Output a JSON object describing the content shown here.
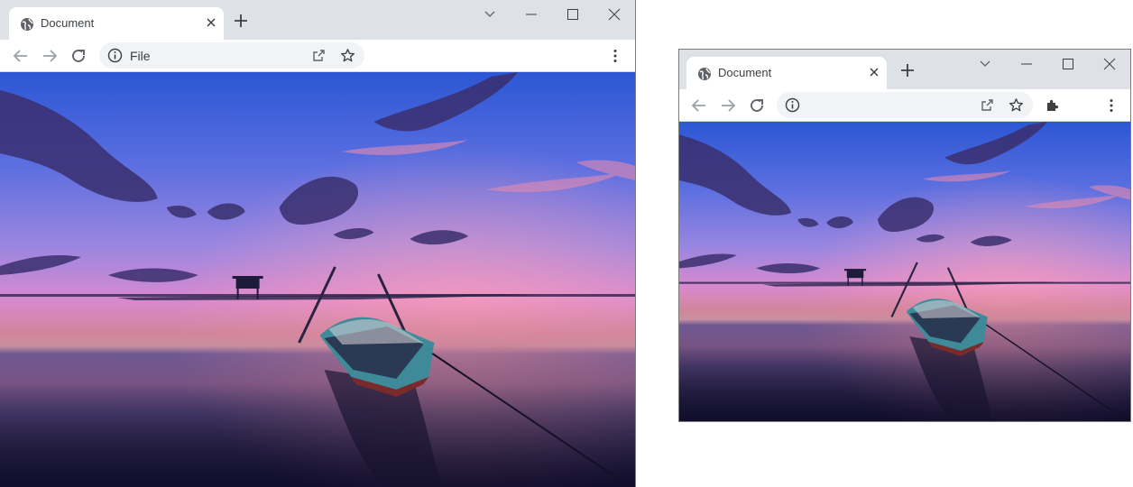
{
  "window_large": {
    "tab": {
      "title": "Document"
    },
    "address": {
      "text": "File"
    }
  },
  "window_small": {
    "tab": {
      "title": "Document"
    },
    "address": {
      "text": ""
    }
  },
  "icons": {
    "favicon": "globe-icon",
    "tab_close": "close-icon",
    "new_tab": "plus-icon",
    "tab_search": "chevron-down-icon",
    "minimize": "minimize-icon",
    "maximize": "maximize-icon",
    "close_window": "close-icon",
    "back": "back-arrow-icon",
    "forward": "forward-arrow-icon",
    "reload": "reload-icon",
    "site_info": "info-icon",
    "share": "share-icon",
    "bookmark": "star-icon",
    "extensions": "puzzle-icon",
    "menu": "kebab-menu-icon"
  },
  "colors": {
    "tabbar_bg": "#dee1e6",
    "omnibox_bg": "#f1f3f4",
    "icon_gray": "#5f6368",
    "icon_disabled": "#9aa0a6",
    "sky_top": "#2f5fd8",
    "sky_mid": "#c77fd6",
    "horizon_pink": "#f07aa0",
    "water_dark": "#1d1840"
  }
}
